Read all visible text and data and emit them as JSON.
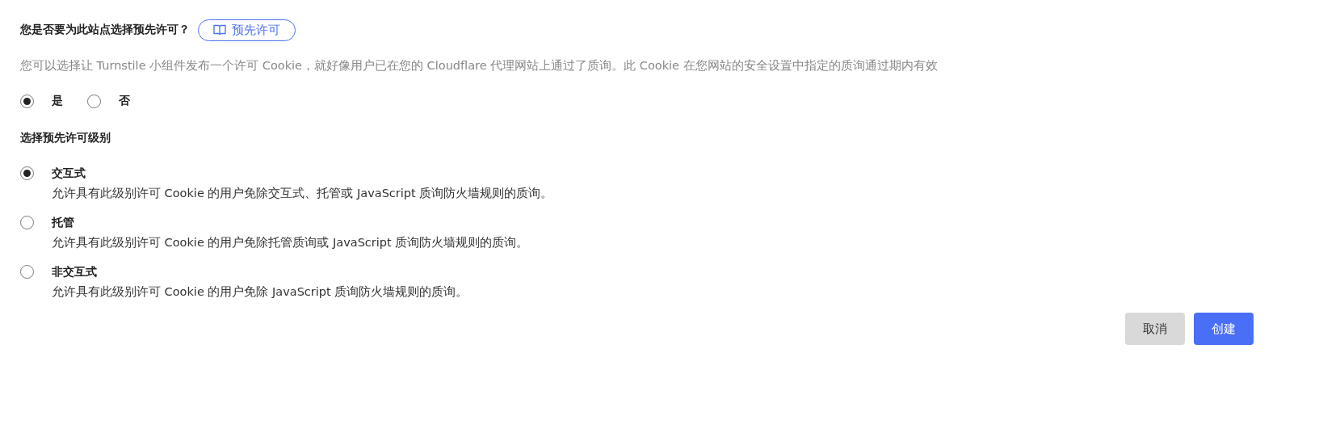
{
  "question": {
    "label": "您是否要为此站点选择预先许可？",
    "link": "预先许可"
  },
  "description": "您可以选择让 Turnstile 小组件发布一个许可 Cookie，就好像用户已在您的 Cloudflare 代理网站上通过了质询。此 Cookie 在您网站的安全设置中指定的质询通过期内有效",
  "choice": [
    {
      "label": "是",
      "selected": true
    },
    {
      "label": "否",
      "selected": false
    }
  ],
  "level_heading": "选择预先许可级别",
  "levels": [
    {
      "label": "交互式",
      "description": "允许具有此级别许可 Cookie 的用户免除交互式、托管或 JavaScript 质询防火墙规则的质询。",
      "selected": true
    },
    {
      "label": "托管",
      "description": "允许具有此级别许可 Cookie 的用户免除托管质询或 JavaScript 质询防火墙规则的质询。",
      "selected": false
    },
    {
      "label": "非交互式",
      "description": "允许具有此级别许可 Cookie 的用户免除 JavaScript 质询防火墙规则的质询。",
      "selected": false
    }
  ],
  "buttons": [
    {
      "label": "取消",
      "kind": "secondary"
    },
    {
      "label": "创建",
      "kind": "primary"
    }
  ]
}
